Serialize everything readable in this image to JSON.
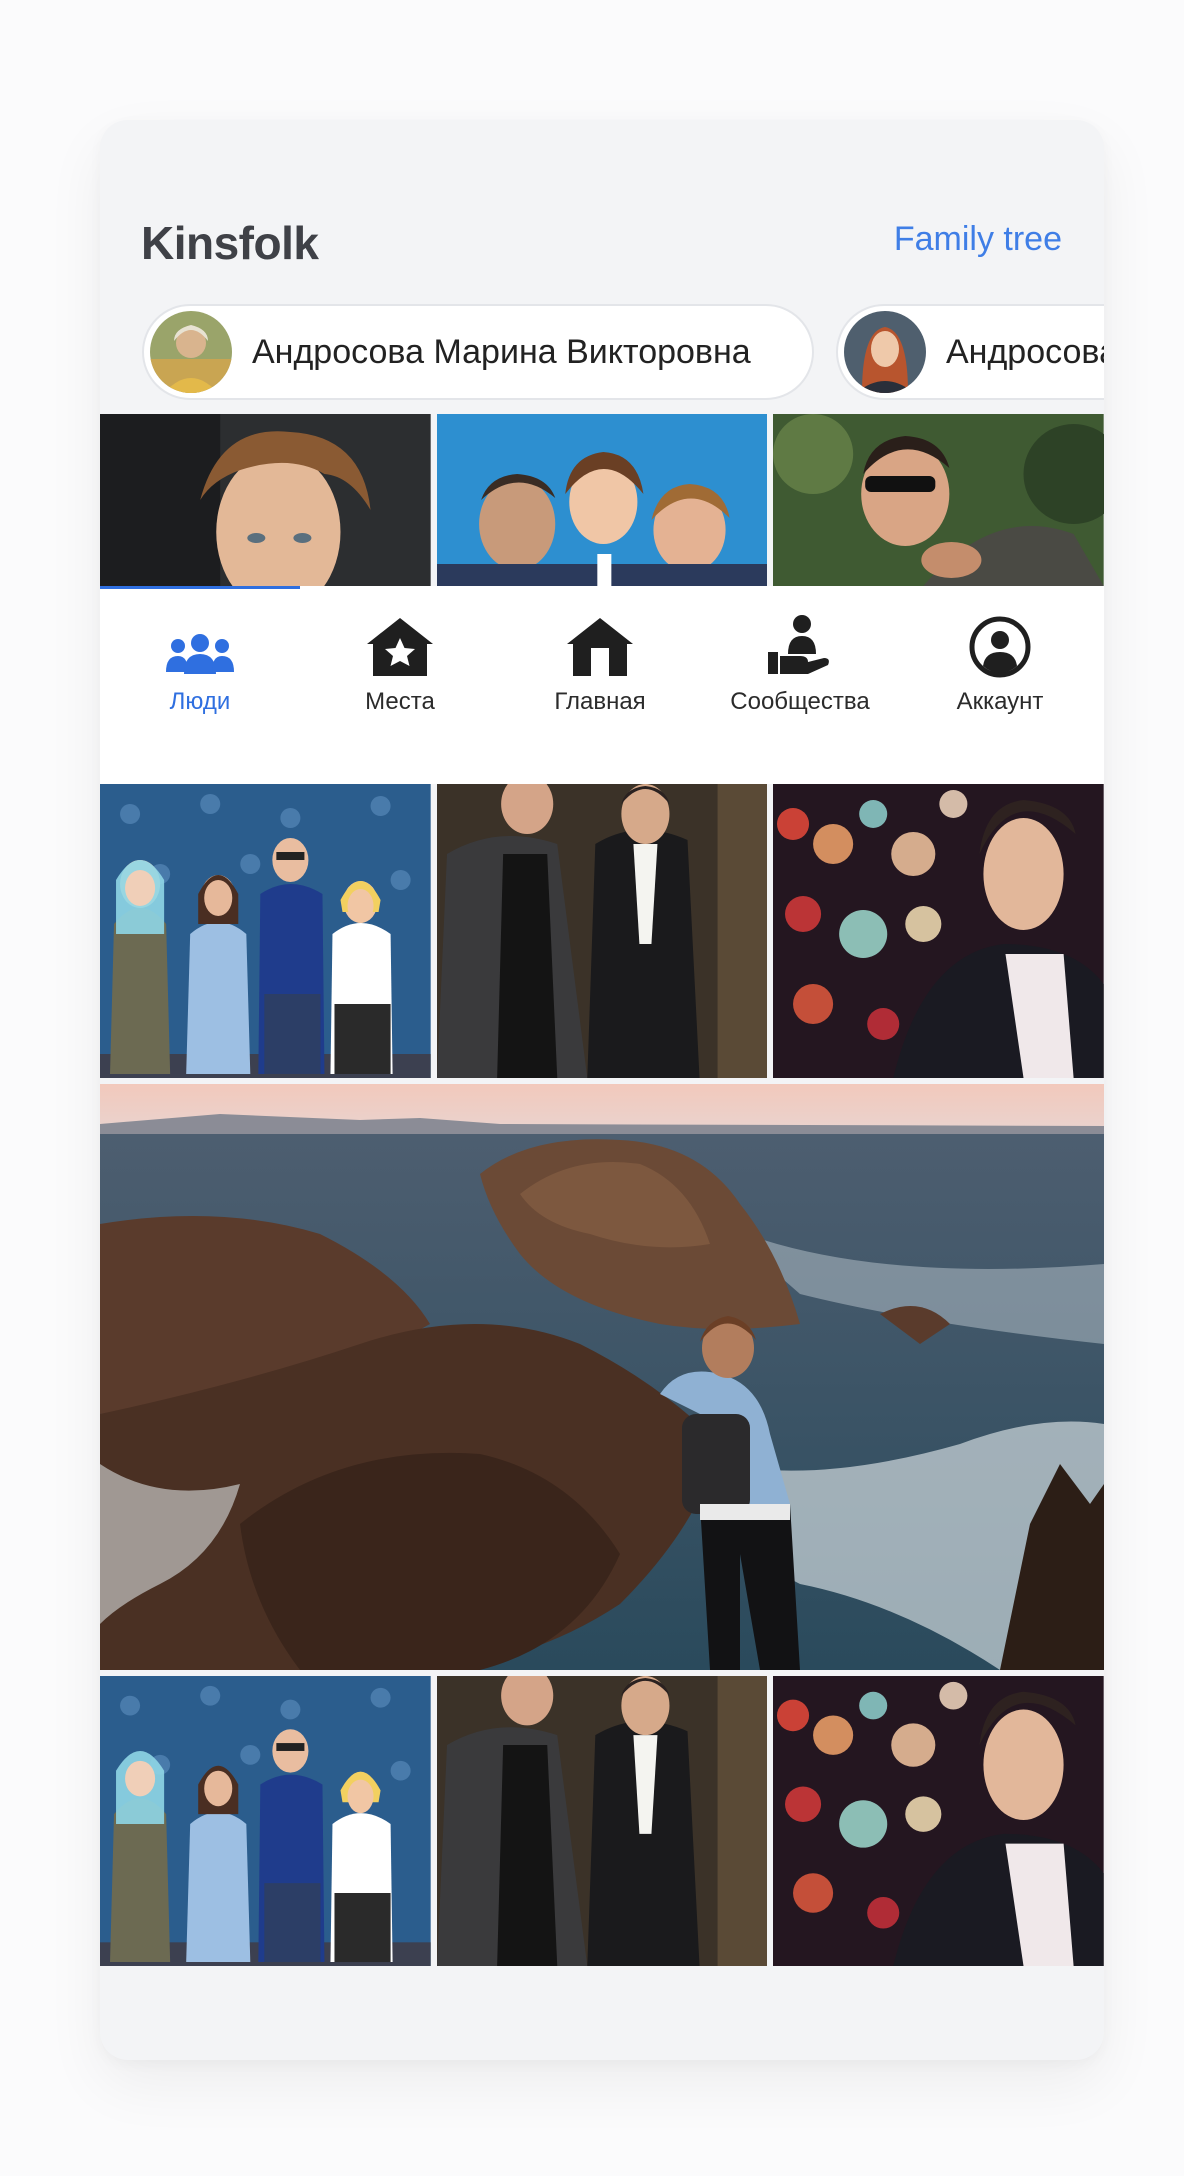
{
  "header": {
    "title": "Kinsfolk",
    "tree_link": "Family tree"
  },
  "chips": [
    {
      "name": "Андросова Марина Викторовна",
      "avatar_icon": "avatar-photo"
    },
    {
      "name": "Андросова",
      "avatar_icon": "avatar-photo"
    }
  ],
  "tabs": [
    {
      "label": "Люди",
      "icon": "people-icon",
      "active": true
    },
    {
      "label": "Места",
      "icon": "places-icon"
    },
    {
      "label": "Главная",
      "icon": "home-icon"
    },
    {
      "label": "Сообщества",
      "icon": "communities-icon"
    },
    {
      "label": "Аккаунт",
      "icon": "account-icon"
    }
  ],
  "colors": {
    "accent": "#2f6fe0",
    "link": "#3f7ee6",
    "title": "#3f4147"
  }
}
